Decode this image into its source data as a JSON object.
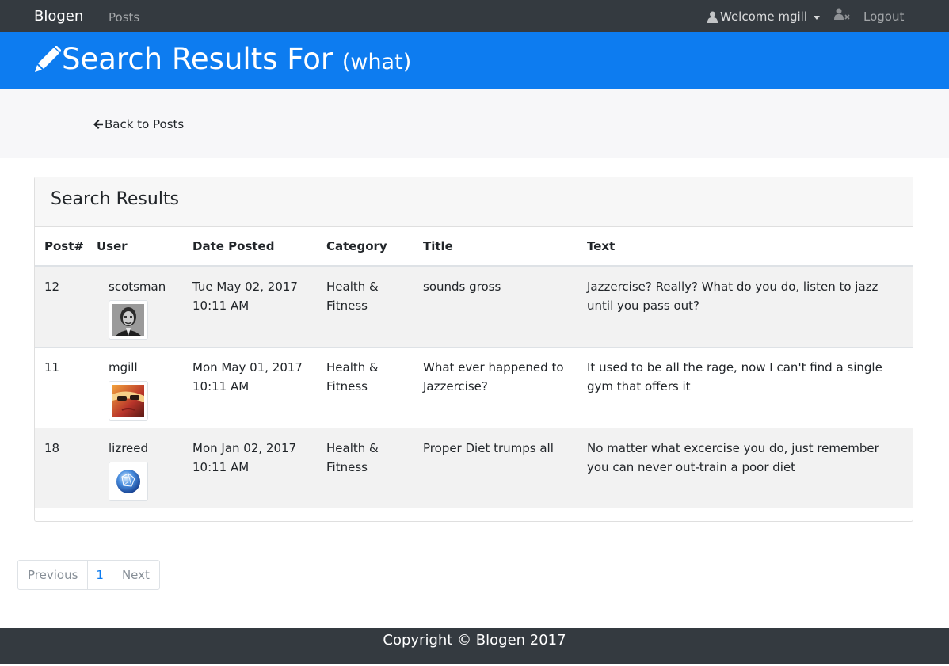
{
  "nav": {
    "brand": "Blogen",
    "posts_link": "Posts",
    "welcome": "Welcome mgill",
    "logout": "Logout"
  },
  "header": {
    "title": "Search Results For",
    "query": "(what)"
  },
  "back_link": "Back to Posts",
  "results": {
    "card_title": "Search Results",
    "columns": [
      "Post#",
      "User",
      "Date Posted",
      "Category",
      "Title",
      "Text"
    ],
    "rows": [
      {
        "post": "12",
        "user": "scotsman",
        "avatar": "portrait-avatar",
        "date_line1": "Tue May 02, 2017",
        "date_line2": "10:11 AM",
        "category": "Health & Fitness",
        "title": "sounds gross",
        "text": "Jazzercise? Really? What do you do, listen to jazz until you pass out?"
      },
      {
        "post": "11",
        "user": "mgill",
        "avatar": "photo-avatar",
        "date_line1": "Mon May 01, 2017",
        "date_line2": "10:11 AM",
        "category": "Health & Fitness",
        "title": "What ever happened to Jazzercise?",
        "text": "It used to be all the rage, now I can't find a single gym that offers it"
      },
      {
        "post": "18",
        "user": "lizreed",
        "avatar": "globe-avatar",
        "date_line1": "Mon Jan 02, 2017",
        "date_line2": "10:11 AM",
        "category": "Health & Fitness",
        "title": "Proper Diet trumps all",
        "text": "No matter what excercise you do, just remember you can never out-train a poor diet"
      }
    ]
  },
  "pagination": {
    "previous": "Previous",
    "page": "1",
    "next": "Next"
  },
  "footer": "Copyright © Blogen 2017",
  "colors": {
    "navbar": "#343a40",
    "primary": "#0d7cf0",
    "band": "#f7f7f9",
    "stripe": "#f2f2f2"
  }
}
